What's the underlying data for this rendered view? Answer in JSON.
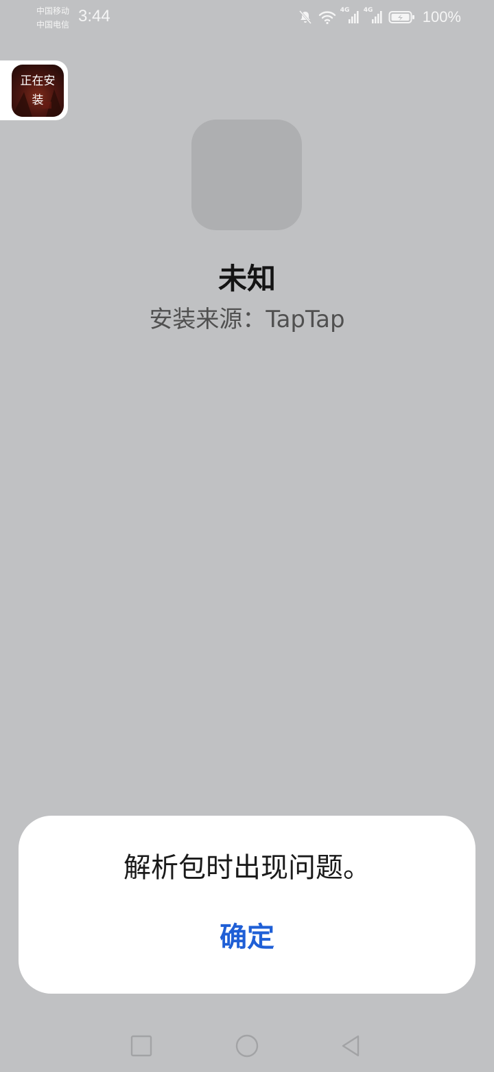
{
  "status_bar": {
    "carrier_1": "中国移动",
    "carrier_2": "中国电信",
    "time": "3:44",
    "network_1": "4G",
    "network_2": "4G",
    "battery_percent": "100%",
    "icons": [
      "bell-off-icon",
      "wifi-icon",
      "signal-icon",
      "signal-icon",
      "battery-charging-icon"
    ]
  },
  "install_widget": {
    "label": "正在安装"
  },
  "app": {
    "name": "未知",
    "source": "安装来源：TapTap"
  },
  "dialog": {
    "message": "解析包时出现问题。",
    "confirm_label": "确定",
    "accent_color": "#1f5fd6"
  },
  "nav": {
    "icons": [
      "square-recents-icon",
      "circle-home-icon",
      "triangle-back-icon"
    ]
  }
}
